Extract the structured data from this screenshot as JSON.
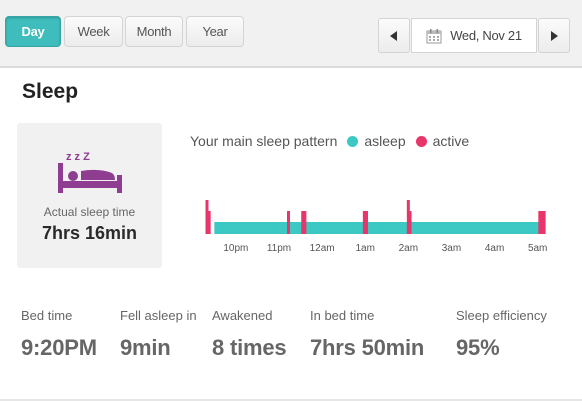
{
  "toolbar": {
    "tabs": [
      {
        "label": "Day",
        "active": true
      },
      {
        "label": "Week",
        "active": false
      },
      {
        "label": "Month",
        "active": false
      },
      {
        "label": "Year",
        "active": false
      }
    ],
    "date": "Wed, Nov 21",
    "prev_icon": "caret-left-icon",
    "next_icon": "caret-right-icon",
    "calendar_icon": "calendar-icon"
  },
  "title": "Sleep",
  "summary": {
    "icon": "bed-sleep-icon",
    "zzz": "z z Z",
    "label": "Actual sleep time",
    "value": "7hrs 16min"
  },
  "legend": {
    "caption": "Your main sleep pattern",
    "asleep": "asleep",
    "active": "active"
  },
  "colors": {
    "accent": "#3fbcbc",
    "asleep": "#3cc9c4",
    "active": "#e8356a",
    "icon": "#8e3d91"
  },
  "chart_data": {
    "type": "timeline",
    "ticks": [
      "10pm",
      "11pm",
      "12am",
      "1am",
      "2am",
      "3am",
      "4am",
      "5am"
    ],
    "start_hour": 21.33,
    "end_hour": 29.17,
    "asleep_range": [
      21.5,
      29.1
    ],
    "active_events": [
      {
        "hour": 21.33,
        "tall": true
      },
      {
        "hour": 21.38,
        "tall": false
      },
      {
        "hour": 23.22,
        "tall": false
      },
      {
        "hour": 23.55,
        "tall": false
      },
      {
        "hour": 23.6,
        "tall": false
      },
      {
        "hour": 24.98,
        "tall": false
      },
      {
        "hour": 25.03,
        "tall": false
      },
      {
        "hour": 26.0,
        "tall": true
      },
      {
        "hour": 26.04,
        "tall": false
      },
      {
        "hour": 29.05,
        "tall": false
      },
      {
        "hour": 29.1,
        "tall": false
      },
      {
        "hour": 29.15,
        "tall": false
      }
    ]
  },
  "stats": [
    {
      "label": "Bed time",
      "value": "9:20PM"
    },
    {
      "label": "Fell asleep in",
      "value": "9min"
    },
    {
      "label": "Awakened",
      "value": "8 times"
    },
    {
      "label": "In bed time",
      "value": "7hrs 50min"
    },
    {
      "label": "Sleep efficiency",
      "value": "95%"
    }
  ]
}
